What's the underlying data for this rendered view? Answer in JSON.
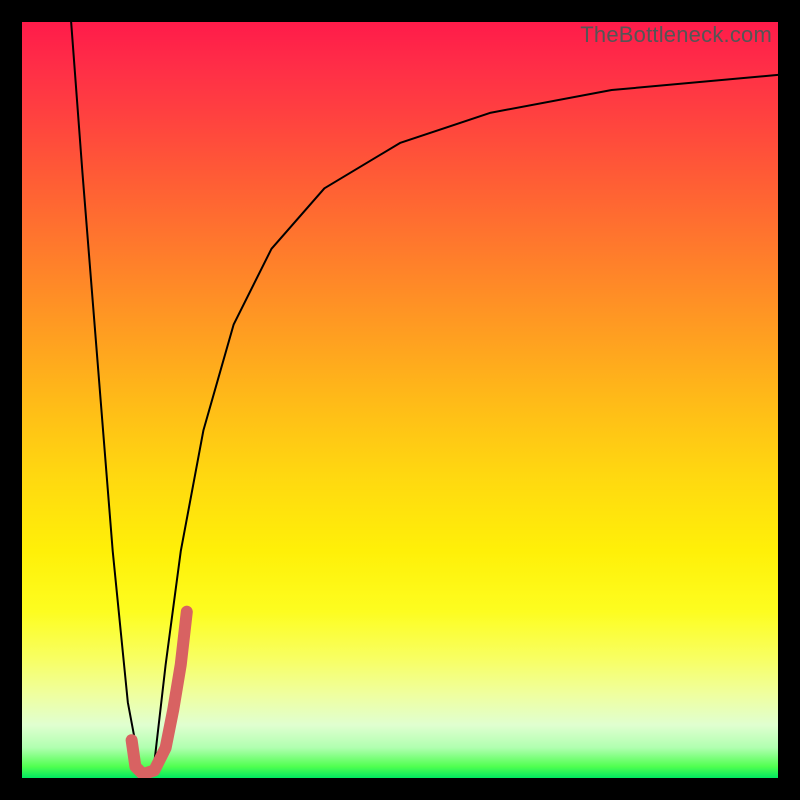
{
  "watermark": "TheBottleneck.com",
  "chart_data": {
    "type": "line",
    "title": "",
    "xlabel": "",
    "ylabel": "",
    "xlim": [
      0,
      100
    ],
    "ylim": [
      0,
      100
    ],
    "grid": false,
    "legend": false,
    "note": "Unlabeled axes; x is horizontal position 0–100, y is vertical (0=bottom, 100=top). Values estimated from pixels.",
    "series": [
      {
        "name": "left-line",
        "color": "#000000",
        "width": 2,
        "x": [
          6.5,
          8,
          10,
          12,
          14,
          15.5
        ],
        "y": [
          100,
          80,
          55,
          30,
          10,
          2
        ]
      },
      {
        "name": "right-curve",
        "color": "#000000",
        "width": 2,
        "x": [
          17.5,
          19,
          21,
          24,
          28,
          33,
          40,
          50,
          62,
          78,
          100
        ],
        "y": [
          2,
          15,
          30,
          46,
          60,
          70,
          78,
          84,
          88,
          91,
          93
        ]
      },
      {
        "name": "marker-J",
        "color": "#d86262",
        "width": 12,
        "x": [
          14.5,
          15,
          16,
          17.5,
          19,
          20,
          21,
          21.8
        ],
        "y": [
          5,
          1.5,
          0.5,
          1,
          4,
          9,
          15,
          22
        ]
      }
    ],
    "gradient_stops": [
      {
        "pos": 0.0,
        "color": "#ff1b4a"
      },
      {
        "pos": 0.5,
        "color": "#ffba18"
      },
      {
        "pos": 0.78,
        "color": "#fdfd20"
      },
      {
        "pos": 1.0,
        "color": "#00e860"
      }
    ]
  }
}
